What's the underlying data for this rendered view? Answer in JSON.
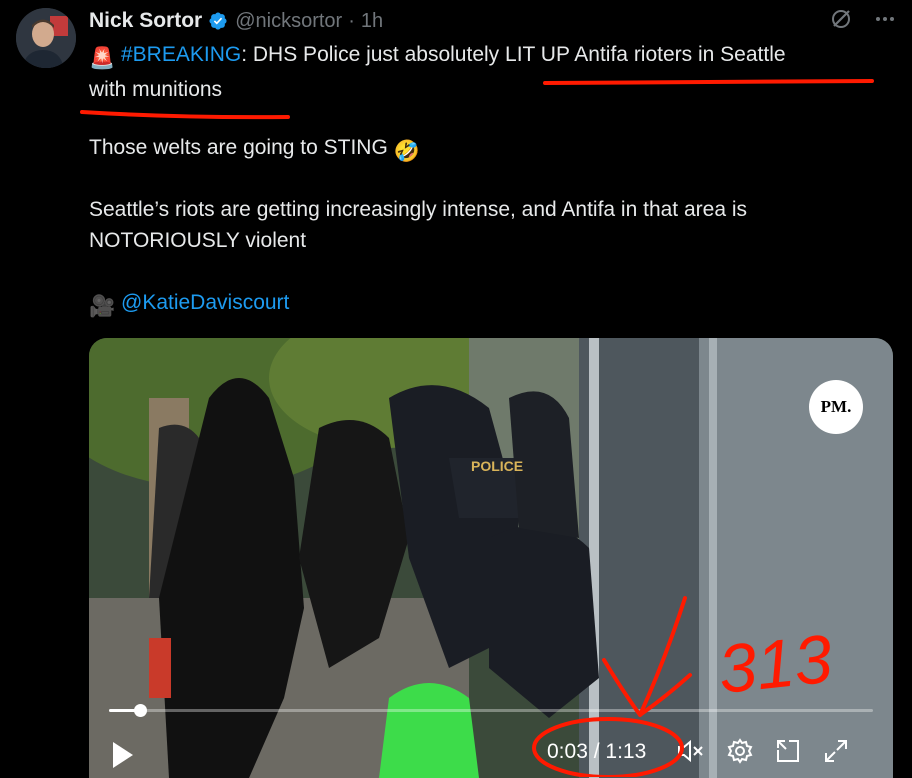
{
  "tweet": {
    "author_name": "Nick Sortor",
    "handle": "@nicksortor",
    "separator": "·",
    "time": "1h",
    "line1": {
      "emoji": "🚨",
      "hashtag": "#BREAKING",
      "text_a": ": DHS Police just absolutely ",
      "text_b": "LIT UP Antifa rioters in Seattle",
      "text_c": "with munitions"
    },
    "p2": {
      "text": "Those welts are going to STING ",
      "emoji": "🤣"
    },
    "p3": "Seattle’s riots are getting increasingly intense, and Antifa in that area is NOTORIOUSLY violent",
    "p4": {
      "emoji": "🎥",
      "mention": "@KatieDaviscourt"
    }
  },
  "video": {
    "watermark": "PM.",
    "sign_text": "POLICE",
    "time_current": "0:03",
    "time_sep": " / ",
    "time_total": "1:13",
    "progress": 0.04
  },
  "annotation": {
    "handwritten": "313",
    "color": "#ff1a00"
  },
  "colors": {
    "background": "#000000",
    "text": "#e7e9ea",
    "secondary": "#71767b",
    "link": "#1d9bf0",
    "verified": "#1d9bf0"
  }
}
